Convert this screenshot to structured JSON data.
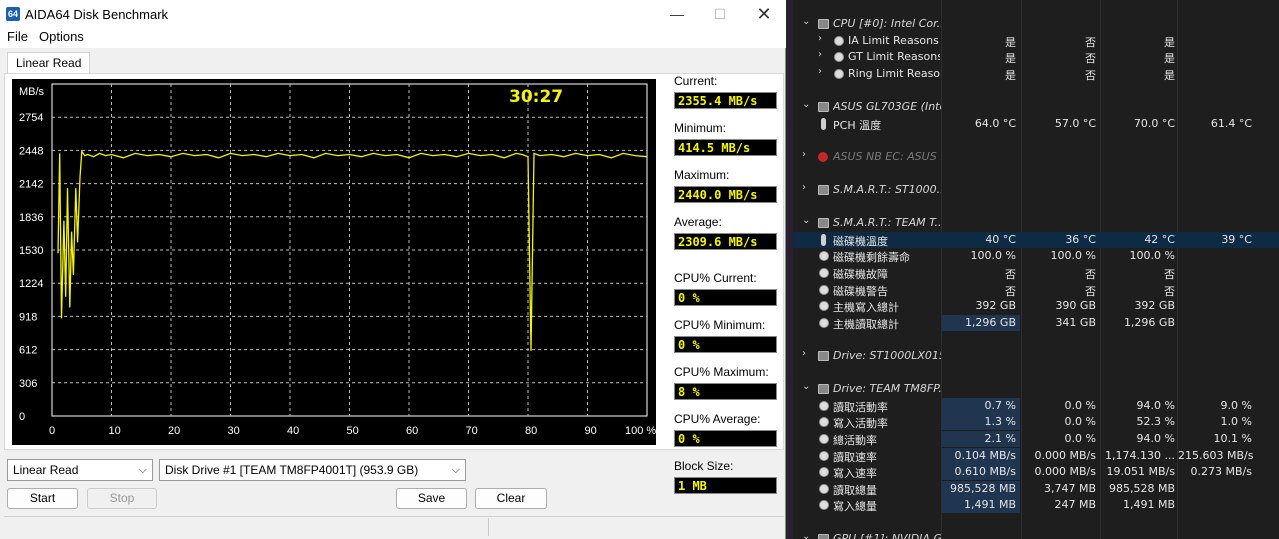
{
  "window": {
    "title": "AIDA64 Disk Benchmark",
    "icon_label": "64",
    "minimize": "—",
    "maximize": "☐",
    "close": "✕"
  },
  "menu": {
    "file": "File",
    "options": "Options"
  },
  "tab": "Linear Read",
  "chart_data": {
    "type": "line",
    "title": "",
    "xlabel": "",
    "ylabel": "MB/s",
    "timer": "30:27",
    "y_ticks": [
      "2754",
      "2448",
      "2142",
      "1836",
      "1530",
      "1224",
      "918",
      "612",
      "306",
      "0"
    ],
    "x_ticks": [
      "0",
      "10",
      "20",
      "30",
      "40",
      "50",
      "60",
      "70",
      "80",
      "90",
      "100 %"
    ],
    "xlim": [
      0,
      100
    ],
    "ylim": [
      0,
      3060
    ],
    "grid": true,
    "series": [
      {
        "color": "#f5f500",
        "x": [
          1,
          1.3,
          1.6,
          2.0,
          2.3,
          2.6,
          3.0,
          3.3,
          3.6,
          4.0,
          4.3,
          4.7,
          5.0,
          5.5,
          6,
          7,
          8,
          9,
          10,
          12,
          14,
          16,
          18,
          20,
          22,
          24,
          26,
          28,
          30,
          32,
          34,
          36,
          38,
          40,
          42,
          44,
          46,
          48,
          50,
          52,
          54,
          56,
          58,
          60,
          62,
          64,
          66,
          68,
          70,
          72,
          74,
          76,
          78,
          79,
          80,
          80.5,
          81,
          82,
          84,
          86,
          88,
          90,
          92,
          94,
          96,
          98,
          100
        ],
        "y": [
          1500,
          2420,
          900,
          1800,
          1100,
          2100,
          1000,
          1700,
          1300,
          2100,
          1600,
          2200,
          2440,
          2400,
          2410,
          2390,
          2420,
          2400,
          2410,
          2380,
          2420,
          2400,
          2410,
          2390,
          2420,
          2400,
          2410,
          2380,
          2420,
          2400,
          2410,
          2390,
          2420,
          2400,
          2410,
          2380,
          2420,
          2400,
          2410,
          2390,
          2420,
          2400,
          2410,
          2380,
          2420,
          2400,
          2410,
          2390,
          2420,
          2400,
          2410,
          2380,
          2420,
          2410,
          2390,
          600,
          2420,
          2400,
          2410,
          2390,
          2420,
          2400,
          2410,
          2380,
          2420,
          2400,
          2390
        ]
      }
    ]
  },
  "stats": {
    "current_label": "Current:",
    "current": "2355.4 MB/s",
    "minimum_label": "Minimum:",
    "minimum": "414.5 MB/s",
    "maximum_label": "Maximum:",
    "maximum": "2440.0 MB/s",
    "average_label": "Average:",
    "average": "2309.6 MB/s",
    "cpu_current_label": "CPU% Current:",
    "cpu_current": "0 %",
    "cpu_minimum_label": "CPU% Minimum:",
    "cpu_minimum": "0 %",
    "cpu_maximum_label": "CPU% Maximum:",
    "cpu_maximum": "8 %",
    "cpu_average_label": "CPU% Average:",
    "cpu_average": "0 %",
    "block_size_label": "Block Size:",
    "block_size": "1 MB"
  },
  "controls": {
    "mode": "Linear Read",
    "drive": "Disk Drive #1  [TEAM TM8FP4001T]  (953.9 GB)",
    "start": "Start",
    "stop": "Stop",
    "save": "Save",
    "clear": "Clear"
  },
  "hwinfo": {
    "rows": [
      {
        "type": "group",
        "icon": "chip-icon",
        "name": "CPU [#0]: Intel Cor...",
        "vals": [
          "",
          "",
          "",
          ""
        ]
      },
      {
        "type": "sub",
        "icon": "clock-icon",
        "name": "IA Limit Reasons",
        "vals": [
          "是",
          "否",
          "是",
          ""
        ]
      },
      {
        "type": "sub",
        "icon": "clock-icon",
        "name": "GT Limit Reasons",
        "vals": [
          "是",
          "否",
          "是",
          ""
        ]
      },
      {
        "type": "sub",
        "icon": "clock-icon",
        "name": "Ring Limit Reasons",
        "vals": [
          "是",
          "否",
          "是",
          ""
        ]
      },
      {
        "type": "blank"
      },
      {
        "type": "group",
        "icon": "chip-icon",
        "name": "ASUS GL703GE (Inte...",
        "vals": [
          "",
          "",
          "",
          ""
        ]
      },
      {
        "type": "item",
        "icon": "thermometer-icon",
        "name": "PCH 溫度",
        "vals": [
          "64.0 °C",
          "57.0 °C",
          "70.0 °C",
          "61.4 °C"
        ]
      },
      {
        "type": "blank"
      },
      {
        "type": "group-disabled",
        "icon": "error-icon",
        "name": "ASUS NB EC: ASUS ...",
        "vals": [
          "",
          "",
          "",
          ""
        ]
      },
      {
        "type": "blank"
      },
      {
        "type": "group",
        "icon": "chip-icon",
        "name": "S.M.A.R.T.: ST1000...",
        "vals": [
          "",
          "",
          "",
          ""
        ]
      },
      {
        "type": "blank"
      },
      {
        "type": "group-open",
        "icon": "chip-icon",
        "name": "S.M.A.R.T.: TEAM T...",
        "vals": [
          "",
          "",
          "",
          ""
        ]
      },
      {
        "type": "item-selected",
        "icon": "thermometer-icon",
        "name": "磁碟機溫度",
        "vals": [
          "40 °C",
          "36 °C",
          "42 °C",
          "39 °C"
        ]
      },
      {
        "type": "item",
        "icon": "clock-icon",
        "name": "磁碟機剩餘壽命",
        "vals": [
          "100.0 %",
          "100.0 %",
          "100.0 %",
          ""
        ]
      },
      {
        "type": "item",
        "icon": "clock-icon",
        "name": "磁碟機故障",
        "vals": [
          "否",
          "否",
          "否",
          ""
        ]
      },
      {
        "type": "item",
        "icon": "clock-icon",
        "name": "磁碟機警告",
        "vals": [
          "否",
          "否",
          "否",
          ""
        ]
      },
      {
        "type": "item",
        "icon": "clock-icon",
        "name": "主機寫入總計",
        "vals": [
          "392 GB",
          "390 GB",
          "392 GB",
          ""
        ]
      },
      {
        "type": "item",
        "icon": "clock-icon",
        "name": "主機讀取總計",
        "vals": [
          "1,296 GB",
          "341 GB",
          "1,296 GB",
          ""
        ]
      },
      {
        "type": "blank"
      },
      {
        "type": "group",
        "icon": "chip-icon",
        "name": "Drive: ST1000LX015...",
        "vals": [
          "",
          "",
          "",
          ""
        ]
      },
      {
        "type": "blank"
      },
      {
        "type": "group-open",
        "icon": "chip-icon",
        "name": "Drive: TEAM TM8FP...",
        "vals": [
          "",
          "",
          "",
          ""
        ]
      },
      {
        "type": "item",
        "icon": "clock-icon",
        "name": "讀取活動率",
        "vals": [
          "0.7 %",
          "0.0 %",
          "94.0 %",
          "9.0 %"
        ]
      },
      {
        "type": "item",
        "icon": "clock-icon",
        "name": "寫入活動率",
        "vals": [
          "1.3 %",
          "0.0 %",
          "52.3 %",
          "1.0 %"
        ]
      },
      {
        "type": "item",
        "icon": "clock-icon",
        "name": "總活動率",
        "vals": [
          "2.1 %",
          "0.0 %",
          "94.0 %",
          "10.1 %"
        ]
      },
      {
        "type": "item",
        "icon": "clock-icon",
        "name": "讀取速率",
        "vals": [
          "0.104 MB/s",
          "0.000 MB/s",
          "1,174.130 ...",
          "215.603 MB/s"
        ]
      },
      {
        "type": "item",
        "icon": "clock-icon",
        "name": "寫入速率",
        "vals": [
          "0.610 MB/s",
          "0.000 MB/s",
          "19.051 MB/s",
          "0.273 MB/s"
        ]
      },
      {
        "type": "item",
        "icon": "clock-icon",
        "name": "讀取總量",
        "vals": [
          "985,528 MB",
          "3,747 MB",
          "985,528 MB",
          ""
        ]
      },
      {
        "type": "item",
        "icon": "clock-icon",
        "name": "寫入總量",
        "vals": [
          "1,491 MB",
          "247 MB",
          "1,491 MB",
          ""
        ]
      },
      {
        "type": "blank"
      },
      {
        "type": "group-cut",
        "icon": "chip-icon",
        "name": "GPU [#1]: NVIDIA G...",
        "vals": [
          "",
          "",
          "",
          ""
        ]
      }
    ]
  }
}
